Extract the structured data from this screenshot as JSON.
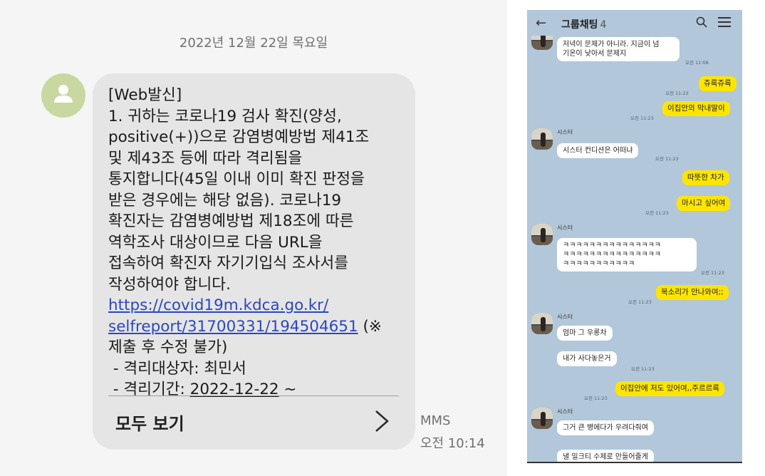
{
  "sms": {
    "date_header": "2022년 12월 22일 목요일",
    "avatar_icon": "person-icon",
    "message_lines": {
      "tag": "[Web발신]",
      "body_1": "1. 귀하는 코로나19 검사 확진(양성,\npositive(+))으로 감염병예방법 제41조\n및 제43조 등에 따라 격리됨을\n통지합니다(45일 이내 이미 확진 판정을\n받은 경우에는 해당 없음). 코로나19\n확진자는 감염병예방법 제18조에 따른\n역학조사 대상이므로 다음 URL을\n접속하여 확진자 자기기입식 조사서를\n작성하여야 합니다.",
      "link_1": "https://covid19m.kdca.go.kr/",
      "link_2": "selfreport/31700331/194504651",
      "after_link": " (※",
      "body_2": "제출 후 수정 불가)\n - 격리대상자: 최민서\n - 격리기간: ",
      "period_date": "2022-12-22",
      "period_tail": " ~"
    },
    "view_all_label": "모두 보기",
    "chevron_icon": "chevron-right-icon",
    "message_type": "MMS",
    "time": "오전 10:14"
  },
  "chat": {
    "back_icon": "back-arrow-icon",
    "title": "그룹채팅",
    "member_count": "4",
    "search_icon": "search-icon",
    "menu_icon": "hamburger-menu-icon",
    "messages": [
      {
        "side": "left",
        "text": "저녁이 문제가 아니라. 지금이 넘\n기온이 낮아서 문제지",
        "time": "오전 11:08"
      },
      {
        "side": "right",
        "text": "쥬륵쥬륵",
        "time": "오전 11:22"
      },
      {
        "side": "right",
        "text": "이집안의 막내딸이",
        "time": "오전 11:23"
      },
      {
        "side": "left",
        "sender": "시스터",
        "text": "시스터 컨디션은 어떠냐",
        "time": "오전 11:23"
      },
      {
        "side": "right",
        "text": "따뜻한 차가",
        "time": ""
      },
      {
        "side": "right",
        "text": "마시고 싶어여",
        "time": "오전 11:23"
      },
      {
        "side": "left",
        "sender": "시스터",
        "text": "ㅋㅋㅋㅋㅋㅋㅋㅋㅋㅋㅋㅋㅋㅋㅋ\nㅋㅋㅋㅋㅋㅋㅋㅋㅋㅋㅋㅋㅋㅋㅋ\nㅋㅋㅋㅋㅋㅋㅋㅋㅋㅋㅋ",
        "time": "오전 11:23"
      },
      {
        "side": "right",
        "text": "목소리가 안나와여;;",
        "time": "오전 11:23"
      },
      {
        "side": "left",
        "sender": "시스터",
        "text": "엄마 그 우롱차",
        "time": ""
      },
      {
        "side": "left",
        "text": "내가 사다놓은거",
        "time": "오전 11:23"
      },
      {
        "side": "right",
        "text": "이집안에 저도 있어여,,주르르륵",
        "time": "오전 11:23"
      },
      {
        "side": "left",
        "sender": "시스터",
        "text": "그거 큰 병에다가 우려다줘여",
        "time": ""
      },
      {
        "side": "left",
        "text": "낼 밀크티 수제로 만들어줄게",
        "time": ""
      }
    ]
  }
}
